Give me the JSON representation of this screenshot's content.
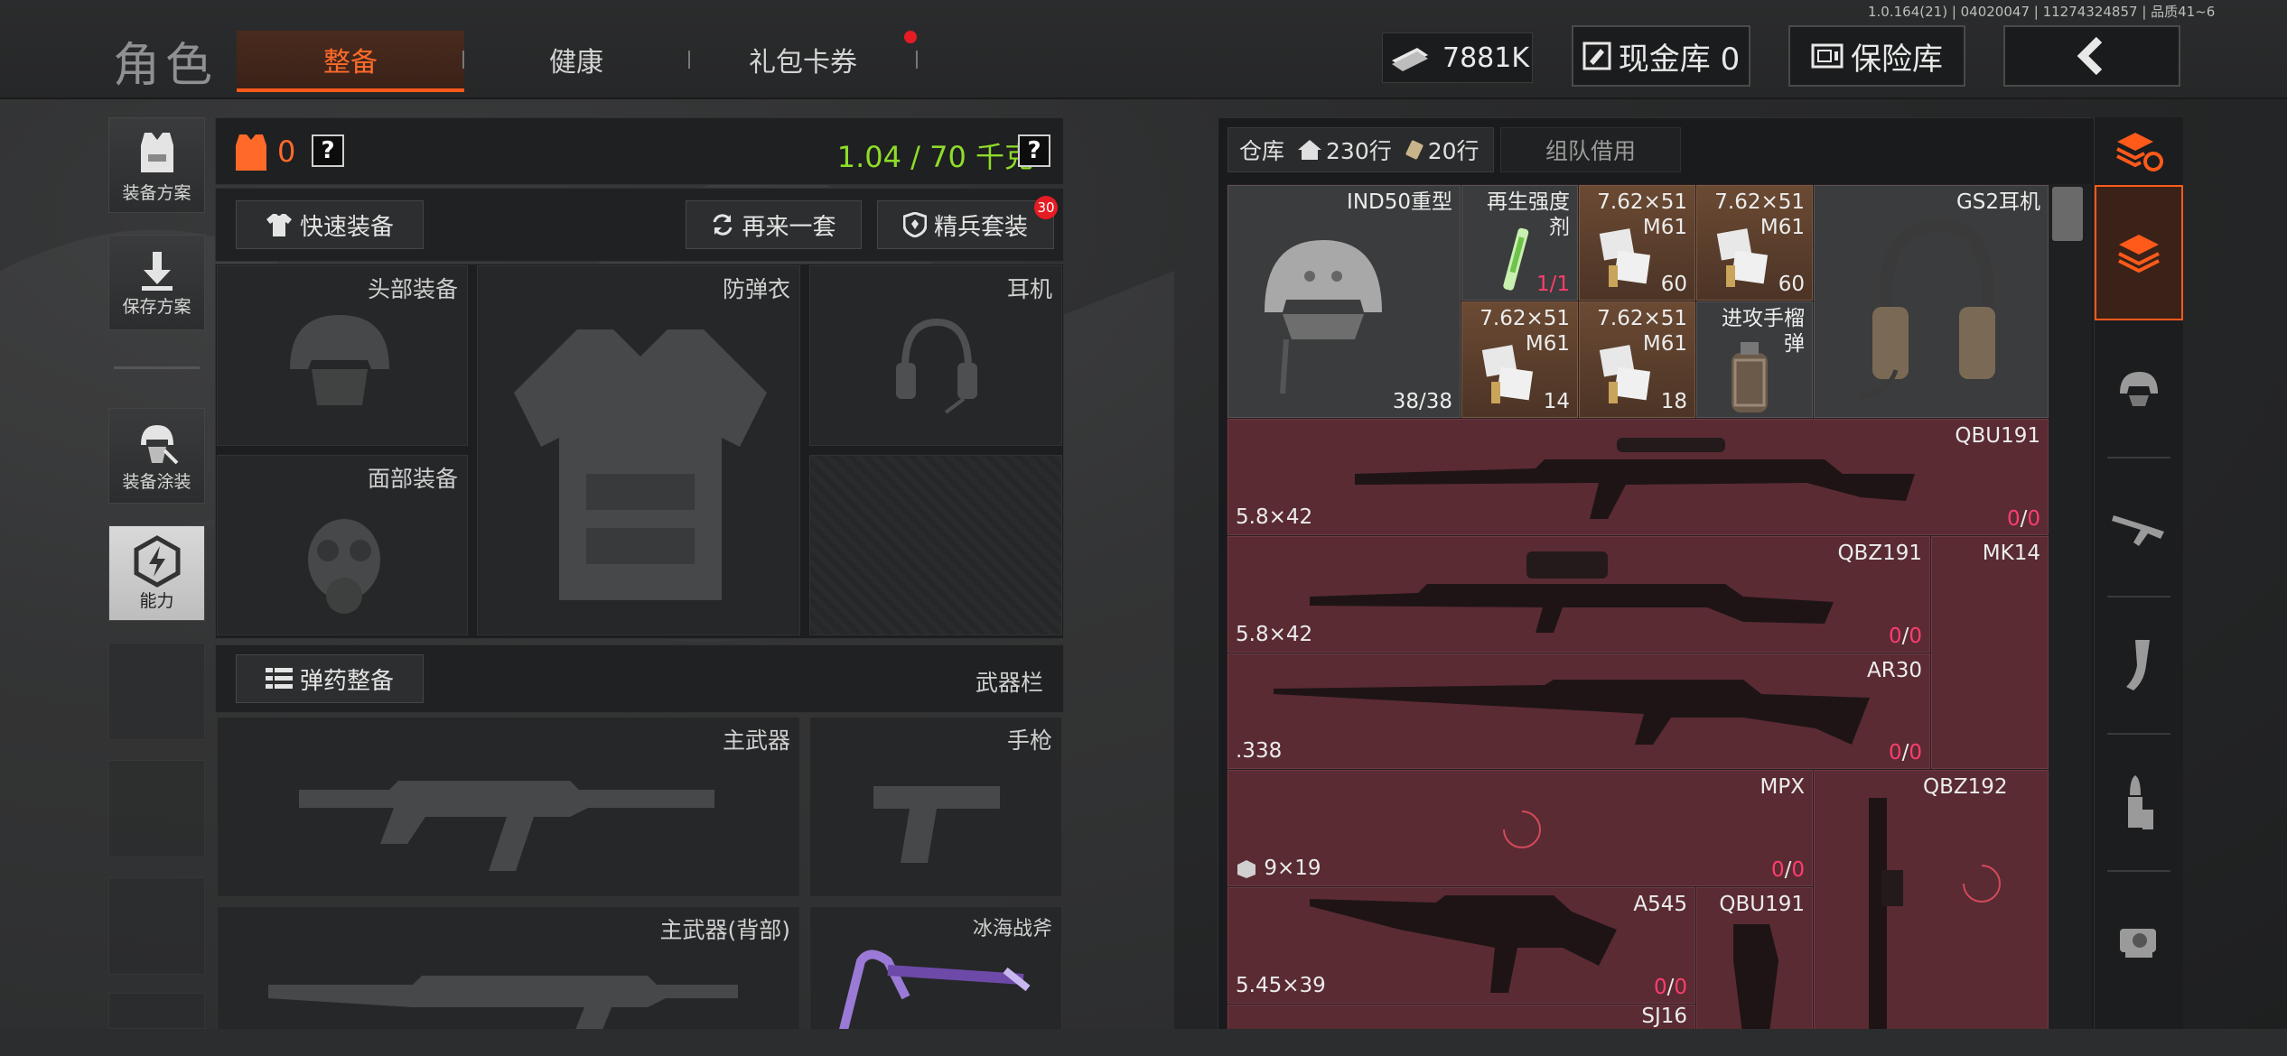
{
  "header": {
    "title": "角色",
    "tabs": [
      {
        "label": "整备",
        "active": true
      },
      {
        "label": "健康",
        "active": false
      },
      {
        "label": "礼包卡券",
        "active": false,
        "badge_dot": true
      }
    ],
    "version": "1.0.164(21) | 04020047 | 11274324857 | 品质41~6",
    "money": "7881K",
    "cash_vault": "现金库 0",
    "safe_box": "保险库",
    "back_icon": "back-arrow-icon"
  },
  "left_column": [
    {
      "label": "装备方案",
      "icon": "vest-plan-icon"
    },
    {
      "label": "保存方案",
      "icon": "save-download-icon"
    },
    {
      "label": "装备涂装",
      "icon": "skin-helmet-icon"
    },
    {
      "label": "能力",
      "icon": "ability-bolt-icon"
    }
  ],
  "loadout": {
    "armor_count": "0",
    "weight": "1.04 / 70 千克",
    "help_glyph": "?",
    "quick_equip": "快速装备",
    "again_set": "再来一套",
    "elite_set": "精兵套装",
    "elite_badge": "30",
    "slots": {
      "head": "头部装备",
      "vest": "防弹衣",
      "headset": "耳机",
      "face": "面部装备"
    },
    "ammo_button": "弹药整备",
    "weapon_bar": "武器栏",
    "primary": "主武器",
    "pistol": "手枪",
    "primary_back": "主武器(背部)",
    "melee": "冰海战斧"
  },
  "warehouse": {
    "tab_label": "仓库",
    "rows_home": "230行",
    "rows_ticket": "20行",
    "team_borrow": "组队借用",
    "items": [
      {
        "name": "IND50重型",
        "count": "38/38",
        "icon": "helmet-icon"
      },
      {
        "name": "再生强度剂",
        "count": "1/1",
        "icon": "syringe-icon"
      },
      {
        "name": "7.62×51 M61",
        "count": "60",
        "icon": "ammo-box-icon"
      },
      {
        "name": "7.62×51 M61",
        "count": "60",
        "icon": "ammo-box-icon"
      },
      {
        "name": "GS2耳机",
        "count": "",
        "icon": "headset-icon"
      },
      {
        "name": "7.62×51 M61",
        "count": "14",
        "icon": "ammo-box-icon"
      },
      {
        "name": "7.62×51 M61",
        "count": "18",
        "icon": "ammo-box-icon"
      },
      {
        "name": "进攻手榴弹",
        "count": "",
        "icon": "grenade-icon"
      },
      {
        "name": "QBU191",
        "caliber": "5.8×42",
        "ammo": "0",
        "ammo_max": "0",
        "icon": "rifle-icon"
      },
      {
        "name": "QBZ191",
        "caliber": "5.8×42",
        "ammo": "0",
        "ammo_max": "0",
        "icon": "rifle-icon"
      },
      {
        "name": "MK14",
        "caliber": "",
        "ammo": "",
        "ammo_max": "",
        "icon": "rifle-icon"
      },
      {
        "name": "AR30",
        "caliber": ".338",
        "ammo": "0",
        "ammo_max": "0",
        "icon": "sniper-icon"
      },
      {
        "name": "MPX",
        "caliber": "9×19",
        "ammo": "0",
        "ammo_max": "0",
        "icon": "smg-icon"
      },
      {
        "name": "QBZ192",
        "caliber": "",
        "ammo": "",
        "ammo_max": "",
        "icon": "rifle-icon"
      },
      {
        "name": "A545",
        "caliber": "5.45×39",
        "ammo": "0",
        "ammo_max": "0",
        "icon": "rifle-icon"
      },
      {
        "name": "QBU191",
        "caliber": "",
        "ammo": "",
        "ammo_max": "",
        "icon": "rifle-icon"
      },
      {
        "name": "SJ16",
        "caliber": "",
        "ammo": "",
        "ammo_max": "",
        "icon": "rifle-icon"
      }
    ],
    "ammo_sep": "/"
  },
  "right_filters": [
    {
      "icon": "sort-refresh-icon"
    },
    {
      "icon": "all-items-icon",
      "active": true
    },
    {
      "icon": "helmet-filter-icon"
    },
    {
      "icon": "rifle-filter-icon"
    },
    {
      "icon": "magazine-filter-icon"
    },
    {
      "icon": "bullet-filter-icon"
    },
    {
      "icon": "scope-filter-icon"
    }
  ],
  "colors": {
    "accent": "#ff5a1a",
    "weight_green": "#8edc2a",
    "ammo_pink": "#ff3d6e",
    "weapon_bg": "#5a2b33",
    "ammo_bg": "#6b4a33"
  }
}
